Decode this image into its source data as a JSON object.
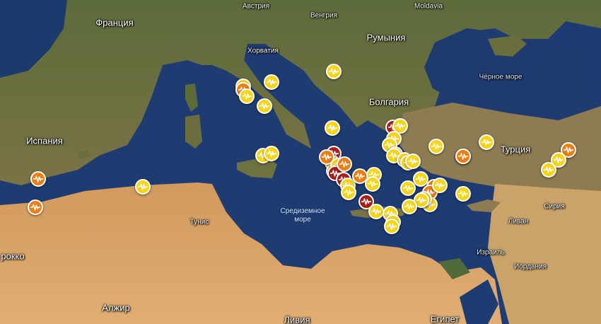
{
  "labels": {
    "austria": "Австрия",
    "hungary": "Венгрия",
    "moldova": "Moldavia",
    "france": "Франция",
    "croatia": "Хорватия",
    "romania": "Румыния",
    "black_sea": "Чёрное море",
    "bulgaria": "Болгария",
    "spain": "Испания",
    "turkey": "Турция",
    "tunisia": "Тунис",
    "mediterranean_sea": "Средиземное море",
    "syria": "Сирия",
    "lebanon": "Ливан",
    "israel": "Израиль",
    "jordan": "Иордания",
    "morocco": "рокко",
    "algeria": "Алжир",
    "libya": "Ливия",
    "egypt": "Египет"
  },
  "legend_colors": {
    "low": "#f7d417",
    "medium": "#ec7e14",
    "high": "#a8201a"
  },
  "marker_icon": "seismic-wave-icon",
  "earthquake_markers": [
    {
      "level": "low"
    },
    {
      "level": "medium"
    },
    {
      "level": "low"
    },
    {
      "level": "low"
    },
    {
      "level": "low"
    },
    {
      "level": "low"
    },
    {
      "level": "low"
    },
    {
      "level": "medium"
    },
    {
      "level": "medium"
    },
    {
      "level": "low"
    },
    {
      "level": "low"
    },
    {
      "level": "low"
    },
    {
      "level": "high"
    },
    {
      "level": "low"
    },
    {
      "level": "low"
    },
    {
      "level": "high"
    },
    {
      "level": "low"
    },
    {
      "level": "low"
    },
    {
      "level": "low"
    },
    {
      "level": "low"
    },
    {
      "level": "medium"
    },
    {
      "level": "low"
    },
    {
      "level": "high"
    },
    {
      "level": "medium"
    },
    {
      "level": "high"
    },
    {
      "level": "low"
    },
    {
      "level": "medium"
    },
    {
      "level": "low"
    },
    {
      "level": "low"
    },
    {
      "level": "low"
    },
    {
      "level": "low"
    },
    {
      "level": "low"
    },
    {
      "level": "low"
    },
    {
      "level": "high"
    },
    {
      "level": "low"
    },
    {
      "level": "low"
    },
    {
      "level": "low"
    },
    {
      "level": "low"
    },
    {
      "level": "low"
    },
    {
      "level": "low"
    },
    {
      "level": "low"
    },
    {
      "level": "medium"
    },
    {
      "level": "medium"
    },
    {
      "level": "low"
    },
    {
      "level": "low"
    },
    {
      "level": "low"
    },
    {
      "level": "low"
    },
    {
      "level": "low"
    },
    {
      "level": "medium"
    },
    {
      "level": "low"
    },
    {
      "level": "low"
    },
    {
      "level": "medium"
    },
    {
      "level": "low"
    },
    {
      "level": "low"
    },
    {
      "level": "medium"
    },
    {
      "level": "low"
    }
  ]
}
